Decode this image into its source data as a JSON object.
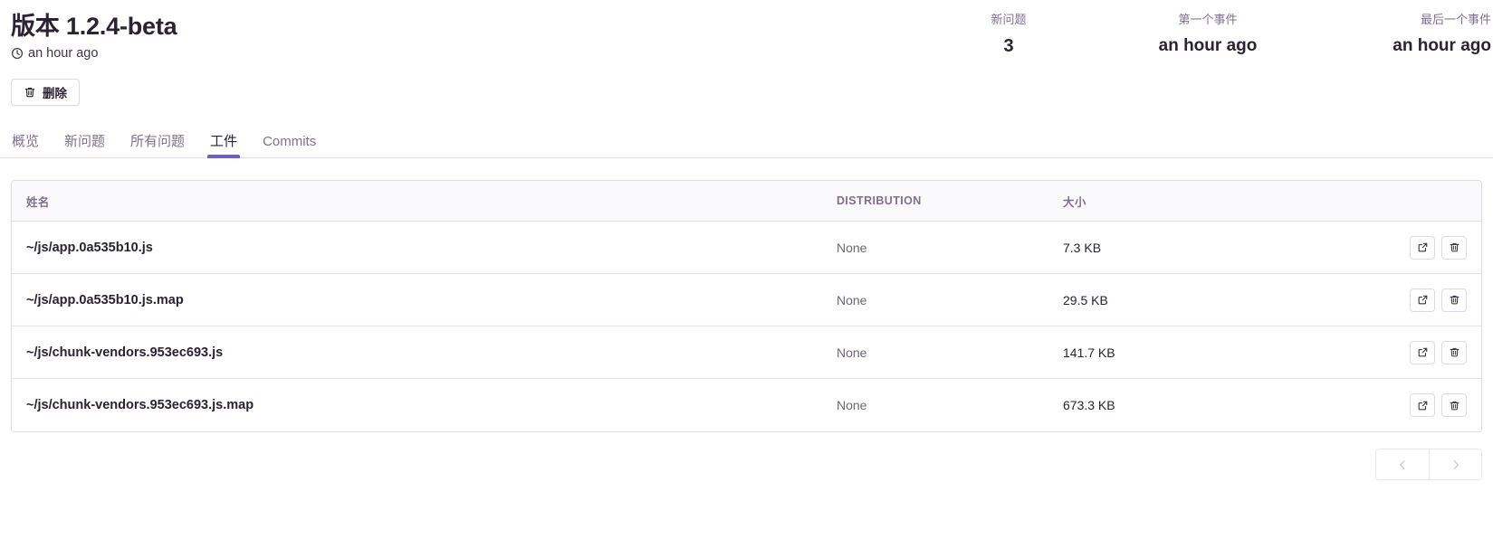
{
  "header": {
    "title": "版本 1.2.4-beta",
    "timestamp": "an hour ago",
    "clock_icon": "clock-icon"
  },
  "stats": [
    {
      "label": "新问题",
      "value": "3",
      "type": "number"
    },
    {
      "label": "第一个事件",
      "value": "an hour ago",
      "type": "time"
    },
    {
      "label": "最后一个事件",
      "value": "an hour ago",
      "type": "time"
    }
  ],
  "actions": {
    "delete_label": "删除",
    "delete_icon": "trash-icon"
  },
  "tabs": [
    {
      "label": "概览",
      "active": false
    },
    {
      "label": "新问题",
      "active": false
    },
    {
      "label": "所有问题",
      "active": false
    },
    {
      "label": "工件",
      "active": true
    },
    {
      "label": "Commits",
      "active": false
    }
  ],
  "table": {
    "columns": {
      "name": "姓名",
      "distribution": "DISTRIBUTION",
      "size": "大小"
    },
    "rows": [
      {
        "name": "~/js/app.0a535b10.js",
        "distribution": "None",
        "size": "7.3 KB",
        "open_icon": "external-link-icon",
        "delete_icon": "trash-icon"
      },
      {
        "name": "~/js/app.0a535b10.js.map",
        "distribution": "None",
        "size": "29.5 KB",
        "open_icon": "external-link-icon",
        "delete_icon": "trash-icon"
      },
      {
        "name": "~/js/chunk-vendors.953ec693.js",
        "distribution": "None",
        "size": "141.7 KB",
        "open_icon": "external-link-icon",
        "delete_icon": "trash-icon"
      },
      {
        "name": "~/js/chunk-vendors.953ec693.js.map",
        "distribution": "None",
        "size": "673.3 KB",
        "open_icon": "external-link-icon",
        "delete_icon": "trash-icon"
      }
    ]
  },
  "pagination": {
    "previous_icon": "chevron-left-icon",
    "next_icon": "chevron-right-icon",
    "previous_disabled": true,
    "next_disabled": true
  },
  "colors": {
    "accent": "#6c5fc7",
    "text_primary": "#2b2233",
    "text_muted": "#80708f",
    "border": "#e0dbe6",
    "header_bg": "#faf9fb"
  }
}
